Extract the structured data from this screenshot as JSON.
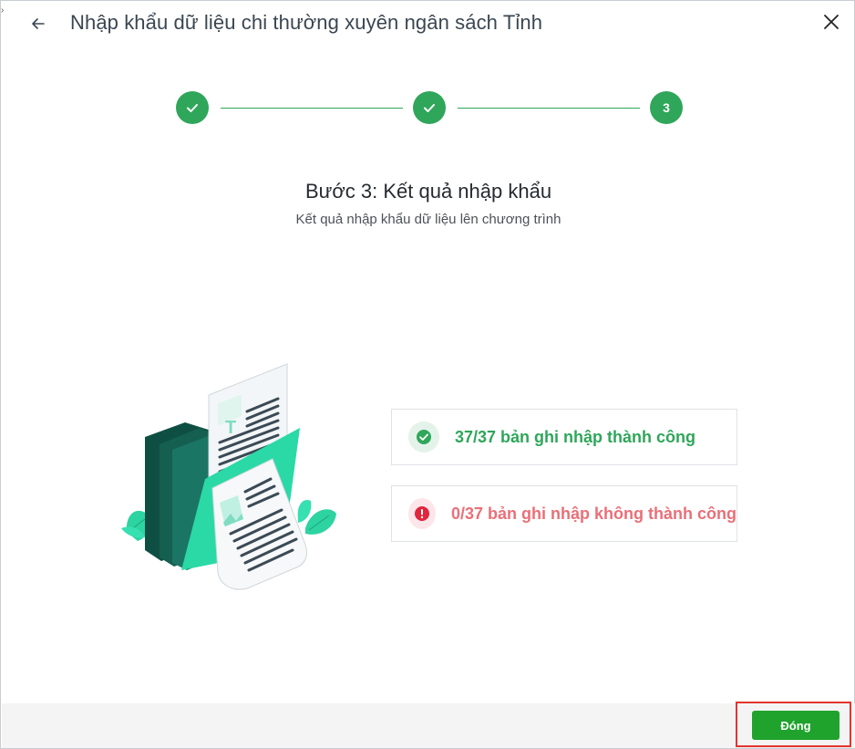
{
  "dialog": {
    "title": "Nhập khẩu dữ liệu chi thường xuyên ngân sách Tỉnh"
  },
  "stepper": {
    "steps": [
      {
        "status": "done",
        "icon": "check-icon"
      },
      {
        "status": "done",
        "icon": "check-icon"
      },
      {
        "status": "current",
        "label": "3"
      }
    ]
  },
  "step": {
    "title": "Bước 3: Kết quả nhập khẩu",
    "subtitle": "Kết quả nhập khẩu dữ liệu lên chương trình"
  },
  "results": {
    "success": {
      "text": "37/37 bản ghi nhập thành công",
      "icon": "check-circle-icon"
    },
    "failure": {
      "text": "0/37 bản ghi nhập không thành công",
      "icon": "exclamation-circle-icon"
    }
  },
  "footer": {
    "close_label": "Đóng"
  },
  "colors": {
    "success": "#2fa65a",
    "error": "#ea6f78",
    "primary_button": "#1fa32c",
    "highlight_border": "#e3342f"
  }
}
